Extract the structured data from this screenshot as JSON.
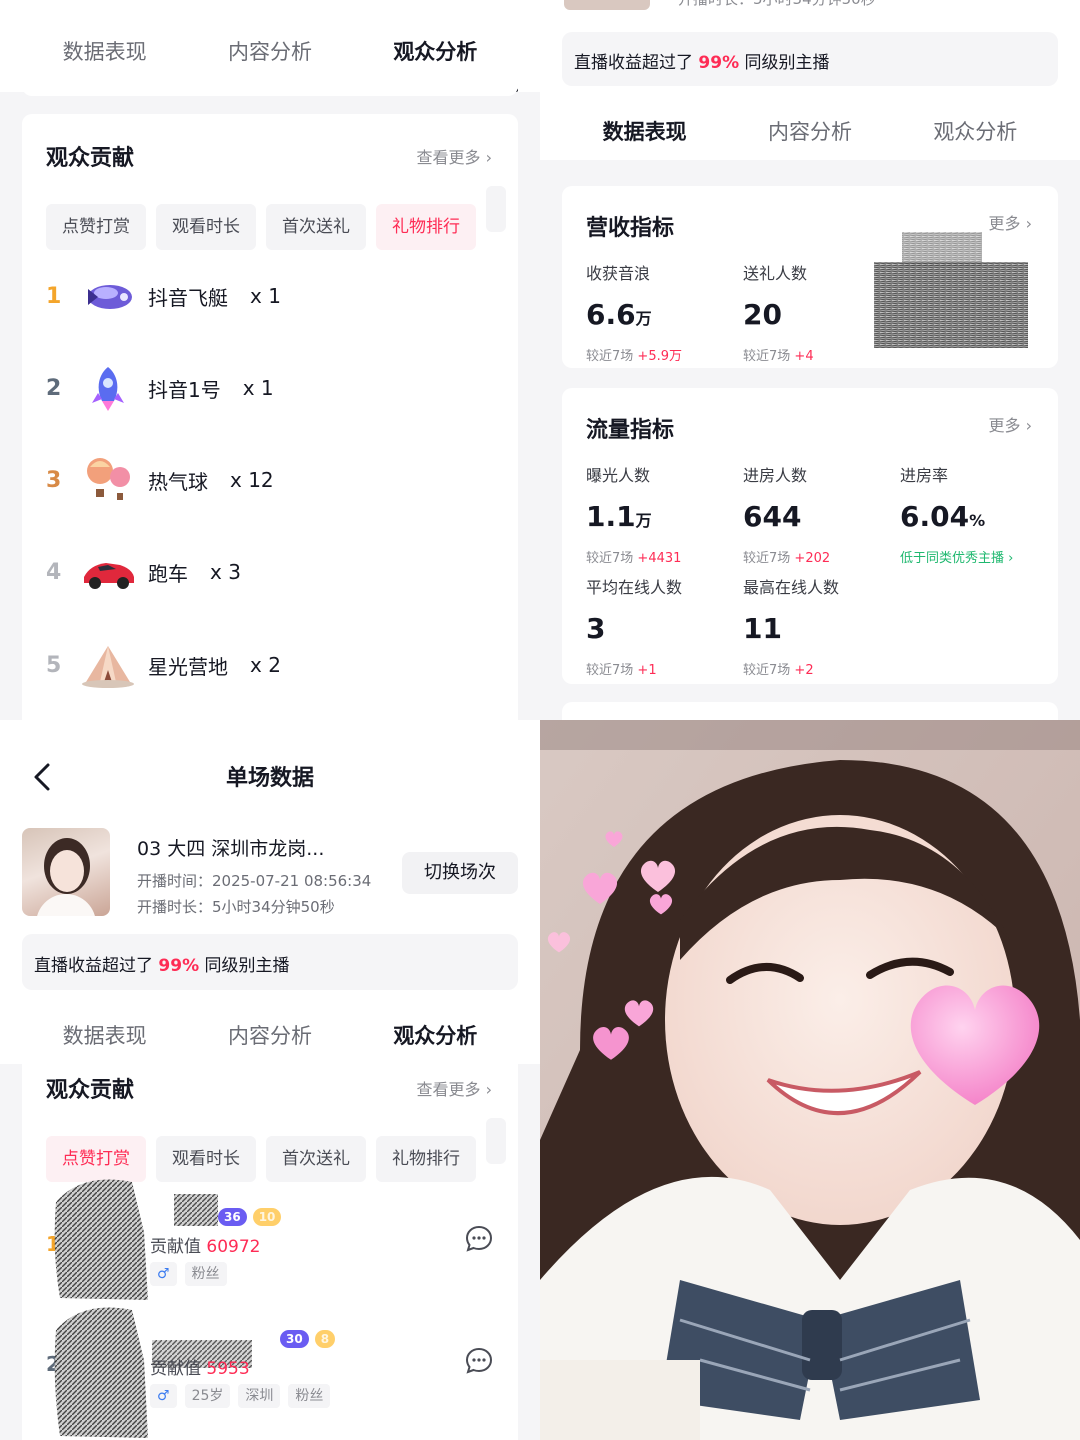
{
  "tabs": [
    "数据表现",
    "内容分析",
    "观众分析"
  ],
  "q1": {
    "section_title": "观众贡献",
    "more": "查看更多",
    "chips": [
      "点赞打赏",
      "观看时长",
      "首次送礼",
      "礼物排行"
    ],
    "active_chip": 3,
    "gifts": [
      {
        "rank": "1",
        "name": "抖音飞艇",
        "count": "x 1",
        "rank_color": "#f4a52b"
      },
      {
        "rank": "2",
        "name": "抖音1号",
        "count": "x 1",
        "rank_color": "#5e6b7a"
      },
      {
        "rank": "3",
        "name": "热气球",
        "count": "x 12",
        "rank_color": "#d88a46"
      },
      {
        "rank": "4",
        "name": "跑车",
        "count": "x 3",
        "rank_color": "#b3b5bb"
      },
      {
        "rank": "5",
        "name": "星光营地",
        "count": "x 2",
        "rank_color": "#b3b5bb"
      }
    ]
  },
  "q2": {
    "top_partial": "开播时长：5小时34分钟50秒",
    "notice_prefix": "直播收益超过了",
    "notice_pct": "99%",
    "notice_suffix": "同级别主播",
    "revenue": {
      "title": "营收指标",
      "more": "更多",
      "metrics": [
        {
          "label": "收获音浪",
          "value": "6.6",
          "unit": "万",
          "sub_prefix": "较近7场",
          "sub_delta": "+5.9万"
        },
        {
          "label": "送礼人数",
          "value": "20",
          "unit": "",
          "sub_prefix": "较近7场",
          "sub_delta": "+4"
        }
      ]
    },
    "traffic": {
      "title": "流量指标",
      "more": "更多",
      "metrics": [
        {
          "label": "曝光人数",
          "value": "1.1",
          "unit": "万",
          "sub_prefix": "较近7场",
          "sub_delta": "+4431"
        },
        {
          "label": "进房人数",
          "value": "644",
          "unit": "",
          "sub_prefix": "较近7场",
          "sub_delta": "+202"
        },
        {
          "label": "进房率",
          "value": "6.04",
          "unit": "%",
          "sub_prefix": "低于同类优秀主播",
          "sub_delta": ""
        },
        {
          "label": "平均在线人数",
          "value": "3",
          "unit": "",
          "sub_prefix": "较近7场",
          "sub_delta": "+1"
        },
        {
          "label": "最高在线人数",
          "value": "11",
          "unit": "",
          "sub_prefix": "较近7场",
          "sub_delta": "+2"
        }
      ]
    }
  },
  "q3": {
    "title": "单场数据",
    "stream_title": "03 大四 深圳市龙岗...",
    "start_time": "开播时间：2025-07-21 08:56:34",
    "duration": "开播时长：5小时34分钟50秒",
    "switch_button": "切换场次",
    "notice_prefix": "直播收益超过了",
    "notice_pct": "99%",
    "notice_suffix": "同级别主播",
    "section_title": "观众贡献",
    "more": "查看更多",
    "chips": [
      "点赞打赏",
      "观看时长",
      "首次送礼",
      "礼物排行"
    ],
    "active_chip": 0,
    "users": [
      {
        "rank": "1",
        "level": "36",
        "fan_level": "10",
        "contrib_label": "贡献值",
        "contrib_value": "60972",
        "tags": [
          "粉丝"
        ]
      },
      {
        "rank": "2",
        "level": "30",
        "fan_level": "8",
        "contrib_label": "贡献值",
        "contrib_value": "5953",
        "tags": [
          "25岁",
          "深圳",
          "粉丝"
        ]
      }
    ]
  },
  "colors": {
    "accent": "#fe2c55",
    "green": "#1fb86f",
    "text": "#161823",
    "muted": "#8a8b91"
  }
}
